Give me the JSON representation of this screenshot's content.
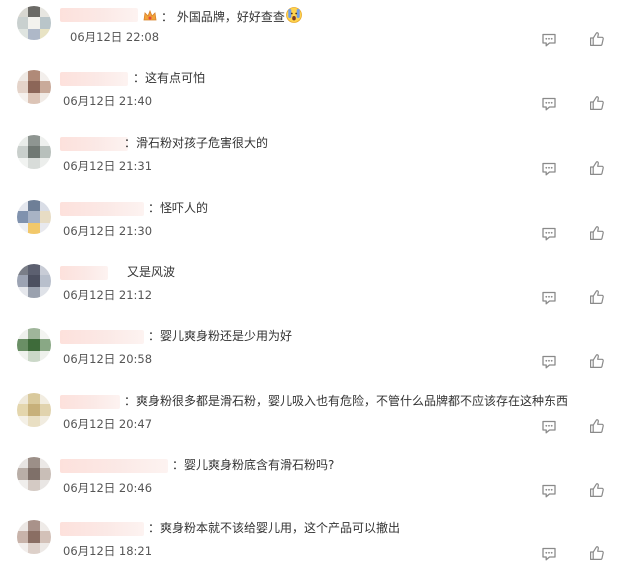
{
  "comments": [
    {
      "text": "： 外国品牌，好好查查",
      "time": "06月12日 22:08"
    },
    {
      "text": "：这有点可怕",
      "time": "06月12日 21:40"
    },
    {
      "text": "：滑石粉对孩子危害很大的",
      "time": "06月12日 21:31"
    },
    {
      "text": "：怪吓人的",
      "time": "06月12日 21:30"
    },
    {
      "text": "又是风波",
      "time": "06月12日 21:12"
    },
    {
      "text": "：婴儿爽身粉还是少用为好",
      "time": "06月12日 20:58"
    },
    {
      "text": "：爽身粉很多都是滑石粉，婴儿吸入也有危险，不管什么品牌都不应该存在这种东西",
      "time": "06月12日 20:47"
    },
    {
      "text": "：婴儿爽身粉底含有滑石粉吗?",
      "time": "06月12日 20:46"
    },
    {
      "text": "：爽身粉本就不该给婴儿用，这个产品可以撤出",
      "time": "06月12日 18:21"
    }
  ],
  "icons": {
    "reply": "comment-bubble-icon",
    "like": "thumbs-up-icon",
    "username_emoji": "crown-emoji-icon",
    "text_emoji": "shocked-face-emoji-icon"
  },
  "colors": {
    "text": "#333333",
    "time": "#555555",
    "icon": "#8a8a8a"
  }
}
